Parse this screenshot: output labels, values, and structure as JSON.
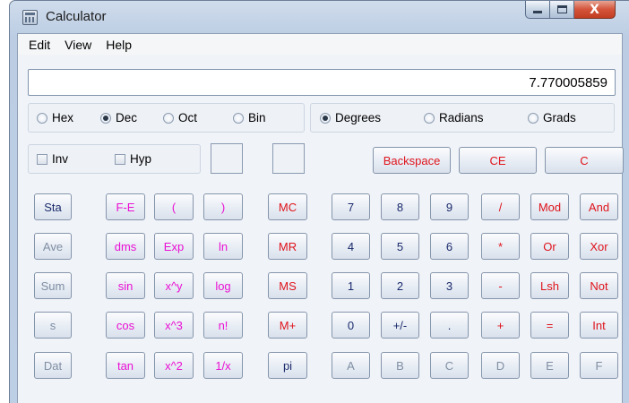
{
  "window": {
    "title": "Calculator",
    "close_glyph": "X"
  },
  "menu": [
    "Edit",
    "View",
    "Help"
  ],
  "display": {
    "value": "7.770005859"
  },
  "base_radios": [
    {
      "label": "Hex",
      "selected": false
    },
    {
      "label": "Dec",
      "selected": true
    },
    {
      "label": "Oct",
      "selected": false
    },
    {
      "label": "Bin",
      "selected": false
    }
  ],
  "angle_radios": [
    {
      "label": "Degrees",
      "selected": true
    },
    {
      "label": "Radians",
      "selected": false
    },
    {
      "label": "Grads",
      "selected": false
    }
  ],
  "checkboxes": [
    {
      "label": "Inv",
      "checked": false
    },
    {
      "label": "Hyp",
      "checked": false
    }
  ],
  "edit_buttons": [
    "Backspace",
    "CE",
    "C"
  ],
  "stat_buttons": [
    "Sta",
    "Ave",
    "Sum",
    "s",
    "Dat"
  ],
  "sci_buttons": [
    [
      "F-E",
      "(",
      ")"
    ],
    [
      "dms",
      "Exp",
      "ln"
    ],
    [
      "sin",
      "x^y",
      "log"
    ],
    [
      "cos",
      "x^3",
      "n!"
    ],
    [
      "tan",
      "x^2",
      "1/x"
    ]
  ],
  "memory_buttons": [
    "MC",
    "MR",
    "MS",
    "M+",
    "pi"
  ],
  "keypad": [
    [
      "7",
      "8",
      "9",
      "/",
      "Mod",
      "And"
    ],
    [
      "4",
      "5",
      "6",
      "*",
      "Or",
      "Xor"
    ],
    [
      "1",
      "2",
      "3",
      "-",
      "Lsh",
      "Not"
    ],
    [
      "0",
      "+/-",
      ".",
      "+",
      "=",
      "Int"
    ],
    [
      "A",
      "B",
      "C",
      "D",
      "E",
      "F"
    ]
  ],
  "colors": {
    "number_text": "#1a2a6c",
    "function_text": "#ea0fd4",
    "operator_text": "#e0141c",
    "disabled_text": "#7f8ea3"
  }
}
